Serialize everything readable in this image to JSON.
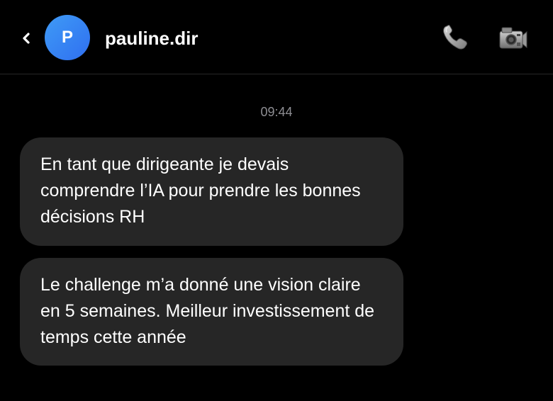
{
  "header": {
    "back_icon": "chevron-left-icon",
    "avatar_initial": "P",
    "username": "pauline.dir",
    "call_icon": "phone-icon",
    "video_icon": "video-camera-icon"
  },
  "conversation": {
    "timestamp": "09:44",
    "messages": [
      {
        "text": "En tant que dirigeante je devais comprendre l’IA pour prendre les bonnes décisions RH"
      },
      {
        "text": "Le challenge m’a donné une vision claire en 5 semaines. Meilleur investissement de temps cette année"
      }
    ]
  },
  "colors": {
    "background": "#000000",
    "bubble": "#262626",
    "avatar_gradient_start": "#3f9bf6",
    "avatar_gradient_end": "#2f6ff0",
    "timestamp": "#8e8e93"
  }
}
